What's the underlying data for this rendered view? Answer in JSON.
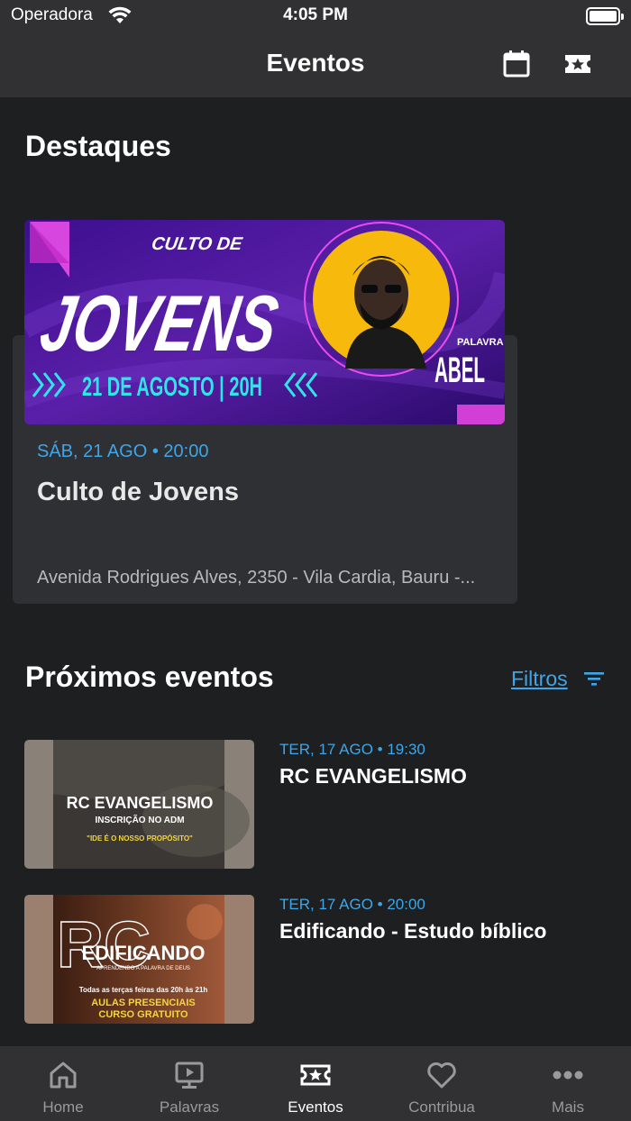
{
  "status_bar": {
    "carrier": "Operadora",
    "time": "4:05 PM"
  },
  "nav": {
    "title": "Eventos"
  },
  "highlights": {
    "title": "Destaques",
    "event": {
      "date": "SÁB, 21 AGO • 20:00",
      "name": "Culto de Jovens",
      "address": "Avenida Rodrigues Alves, 2350 - Vila Cardia, Bauru -...",
      "banner": {
        "top_text": "CULTO DE",
        "main_text": "JOVENS",
        "date_text": "21 DE AGOSTO | 20H",
        "speaker_label": "PALAVRA",
        "speaker_name": "ABEL"
      }
    }
  },
  "upcoming": {
    "title": "Próximos eventos",
    "filters_label": "Filtros",
    "events": [
      {
        "date": "TER, 17 AGO • 19:30",
        "name": "RC EVANGELISMO",
        "thumb": {
          "line1": "RC EVANGELISMO",
          "line2": "INSCRIÇÃO NO ADM",
          "line3": "\"IDE É O NOSSO PROPÓSITO\""
        }
      },
      {
        "date": "TER, 17 AGO • 20:00",
        "name": "Edificando - Estudo bíblico",
        "thumb": {
          "logo": "RC",
          "line1": "EDIFICANDO",
          "line2": "APRENDENDO A PALAVRA DE DEUS",
          "line3": "Todas as terças feiras das 20h às 21h",
          "line4": "AULAS PRESENCIAIS",
          "line5": "CURSO GRATUITO"
        }
      }
    ]
  },
  "tabs": [
    {
      "label": "Home",
      "icon": "home-icon"
    },
    {
      "label": "Palavras",
      "icon": "play-screen-icon"
    },
    {
      "label": "Eventos",
      "icon": "ticket-star-icon",
      "active": true
    },
    {
      "label": "Contribua",
      "icon": "heart-icon"
    },
    {
      "label": "Mais",
      "icon": "more-dots-icon"
    }
  ],
  "colors": {
    "accent": "#3ea6e8",
    "background": "#1e1f21",
    "bar": "#313133",
    "card": "#2f3033",
    "banner_purple": "#5a1fa8",
    "banner_yellow": "#f6b90c",
    "banner_cyan": "#2ee6e8"
  }
}
